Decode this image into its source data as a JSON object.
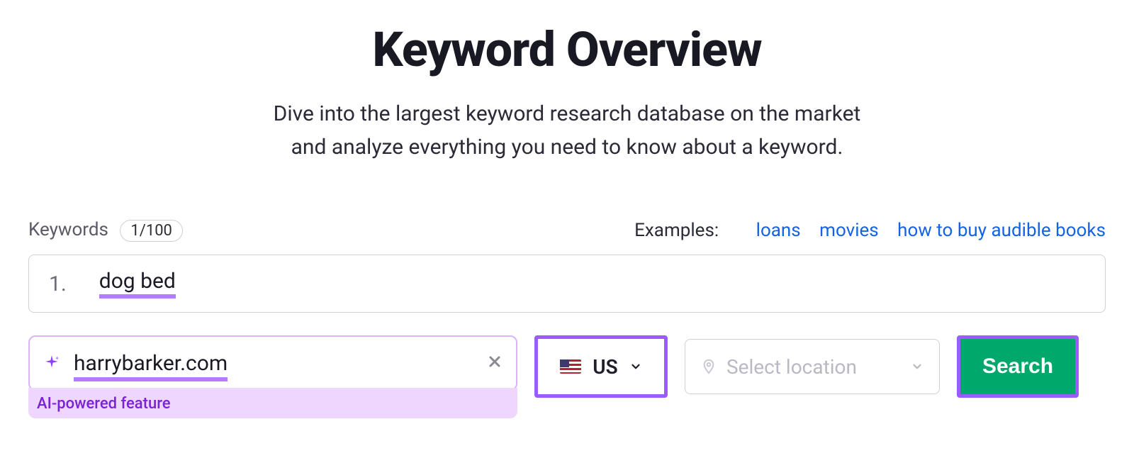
{
  "header": {
    "title": "Keyword Overview",
    "subtitle_line1": "Dive into the largest keyword research database on the market",
    "subtitle_line2": "and analyze everything you need to know about a keyword."
  },
  "keywords": {
    "label": "Keywords",
    "count_badge": "1/100",
    "items": [
      {
        "index": "1.",
        "text": "dog bed"
      }
    ]
  },
  "examples": {
    "label": "Examples:",
    "links": [
      "loans",
      "movies",
      "how to buy audible books"
    ]
  },
  "ai": {
    "domain": "harrybarker.com",
    "caption": "AI-powered feature"
  },
  "country": {
    "code": "US"
  },
  "location": {
    "placeholder": "Select location"
  },
  "actions": {
    "search": "Search"
  }
}
